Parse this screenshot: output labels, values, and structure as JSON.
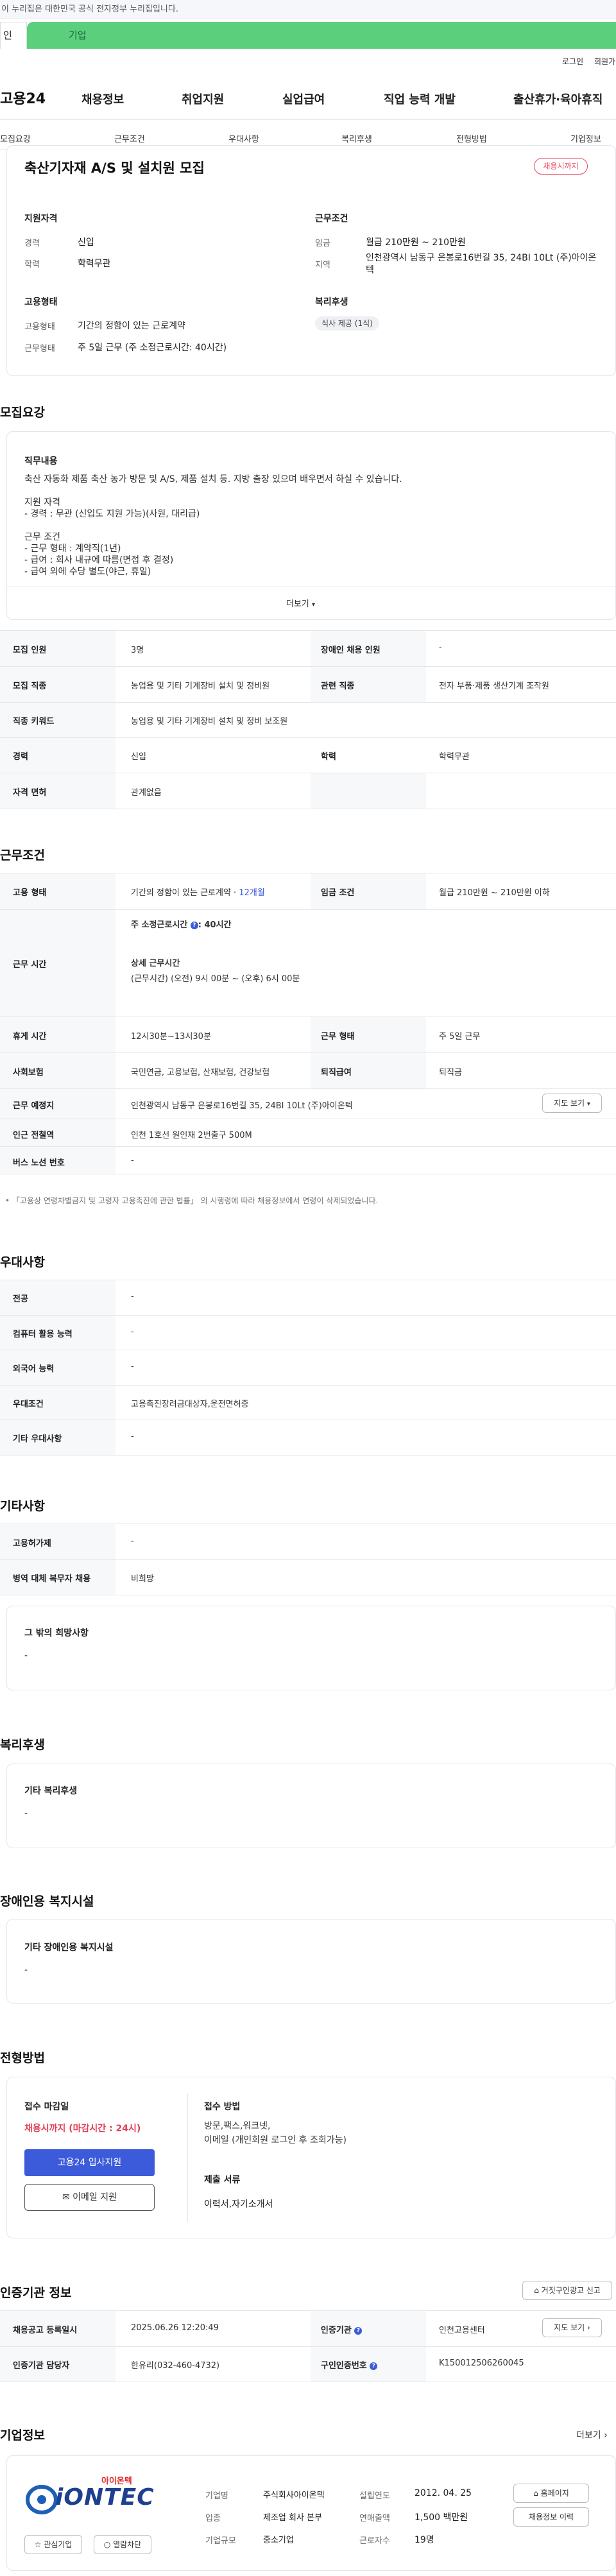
{
  "gov_banner": "이 누리집은 대한민국 공식 전자정부 누리집입니다.",
  "tabs": {
    "a": "인",
    "b": "기업"
  },
  "util": {
    "login": "로그인",
    "join": "회원가"
  },
  "logo": "고용24",
  "gnb": [
    "채용정보",
    "취업지원",
    "실업급여",
    "직업 능력 개발",
    "출산휴가·육아휴직"
  ],
  "subnav": [
    "모집요강",
    "근무조건",
    "우대사항",
    "복리후생",
    "전형방법",
    "기업정보"
  ],
  "job": {
    "title": "축산기자재 A/S 및 설치원 모집",
    "status_badge": "채용시까지",
    "qual_title": "지원자격",
    "career_lbl": "경력",
    "career_val": "신입",
    "edu_lbl": "학력",
    "edu_val": "학력무관",
    "cond_title": "근무조건",
    "wage_lbl": "임금",
    "wage_val": "월급 210만원 ~ 210만원",
    "region_lbl": "지역",
    "region_val": "인천광역시 남동구 은봉로16번길 35, 24BI 10Lt (주)아이온텍",
    "emp_title": "고용형태",
    "emp_lbl": "고용형태",
    "emp_val": "기간의 정함이 있는 근로계약",
    "work_lbl": "근무형태",
    "work_val": "주 5일 근무 (주 소정근로시간: 40시간)",
    "welfare_title": "복리후생",
    "welfare_badge": "식사 제공 (1식)"
  },
  "recruit": {
    "section": "모집요강",
    "duty_title": "직무내용",
    "duty_text": "축산 자동화 제품 축산 농가 방문 및 A/S, 제품 설치 등. 지방 출장 있으며 배우면서 하실 수 있습니다.\n\n지원 자격\n - 경력 : 무관 (신입도 지원 가능)(사원, 대리급)\n\n근무 조건\n - 근무 형태 : 계약직(1년)\n - 급여 : 회사 내규에 따름(면접 후 결정)\n - 급여 외에 수당 별도(야근, 휴일)",
    "more": "더보기",
    "rows": [
      {
        "h1": "모집 인원",
        "v1": "3명",
        "h2": "장애인 채용 인원",
        "v2": "-"
      },
      {
        "h1": "모집 직종",
        "v1": "농업용 및 기타 기계장비 설치 및 정비원",
        "h2": "관련 직종",
        "v2": "전자 부품·제품 생산기계 조작원"
      },
      {
        "h1": "직종 키워드",
        "v1": "농업용 및 기타 기계장비 설치 및 정비 보조원"
      },
      {
        "h1": "경력",
        "v1": "신입",
        "h2": "학력",
        "v2": "학력무관"
      },
      {
        "h1": "자격 면허",
        "v1": "관계없음"
      }
    ]
  },
  "work": {
    "section": "근무조건",
    "emp_h": "고용 형태",
    "emp_v": "기간의 정함이 있는 근로계약 · ",
    "emp_v2": "12개월",
    "wage_h": "임금 조건",
    "wage_v": "월급 210만원 ~ 210만원 이하",
    "time_h": "근무 시간",
    "time_v1": "주 소정근로시간",
    "time_v1b": ": 40시간",
    "time_v2": "상세 근무시간",
    "time_v3": "(근무시간) (오전) 9시 00분 ~ (오후) 6시 00분",
    "rest_h": "휴게 시간",
    "rest_v": "12시30분~13시30분",
    "form_h": "근무 형태",
    "form_v": "주 5일 근무",
    "ins_h": "사회보험",
    "ins_v": "국민연금, 고용보험, 산재보험, 건강보험",
    "ret_h": "퇴직급여",
    "ret_v": "퇴직금",
    "place_h": "근무 예정지",
    "place_v": "인천광역시 남동구 은봉로16번길 35, 24BI 10Lt (주)아이온텍",
    "map_btn": "지도 보기",
    "sub_h": "인근 전철역",
    "sub_v": "인천 1호선 원인재 2번출구 500M",
    "bus_h": "버스 노선 번호",
    "bus_v": "-",
    "note": "「고용상 연령차별금지 및 고령자 고용촉진에 관한 법률」 의 시행령에 따라 채용정보에서 연령이 삭제되었습니다."
  },
  "pref": {
    "section": "우대사항",
    "rows": [
      {
        "h": "전공",
        "v": "-"
      },
      {
        "h": "컴퓨터 활용 능력",
        "v": "-"
      },
      {
        "h": "외국어 능력",
        "v": "-"
      },
      {
        "h": "우대조건",
        "v": "고용촉진장려금대상자,운전면허증"
      },
      {
        "h": "기타 우대사항",
        "v": "-"
      }
    ]
  },
  "etc": {
    "section": "기타사항",
    "rows": [
      {
        "h": "고용허가제",
        "v": "-"
      },
      {
        "h": "병역 대체 복무자 채용",
        "v": "비희망"
      }
    ],
    "box_title": "그 밖의 희망사항",
    "box_val": "-"
  },
  "welfare": {
    "section": "복리후생",
    "box_title": "기타 복리후생",
    "box_val": "-"
  },
  "disabled": {
    "section": "장애인용 복지시설",
    "box_title": "기타 장애인용 복지시설",
    "box_val": "-"
  },
  "screen": {
    "section": "전형방법",
    "deadline_lbl": "접수 마감일",
    "deadline_val": "채용시까지 (마감시간 : 24시)",
    "apply_btn": "고용24 입사지원",
    "email_btn": "이메일 지원",
    "method_lbl": "접수 방법",
    "method_val": "방문,팩스,워크넷,\n이메일 (개인회원 로그인 후 조회가능)",
    "docs_lbl": "제출 서류",
    "docs_val": "이력서,자기소개서"
  },
  "cert": {
    "section": "인증기관 정보",
    "report_btn": "거짓구인광고 신고",
    "r1h1": "채용공고 등록일시",
    "r1v1": "2025.06.26 12:20:49",
    "r1h2": "인증기관",
    "r1v2": "인천고용센터",
    "map_btn": "지도 보기",
    "r2h1": "인증기관 담당자",
    "r2v1": "한유리(032-460-4732)",
    "r2h2": "구인인증번호",
    "r2v2": "K150012506260045"
  },
  "company": {
    "section": "기업정보",
    "more": "더보기",
    "logo_top": "아이온텍",
    "logo_main": "iONTEC",
    "f": [
      {
        "l": "기업명",
        "v": "주식회사아이온텍"
      },
      {
        "l": "업종",
        "v": "제조업 회사 본부"
      },
      {
        "l": "기업규모",
        "v": "중소기업"
      }
    ],
    "g": [
      {
        "l": "설립연도",
        "v": "2012. 04. 25"
      },
      {
        "l": "연매출액",
        "v": "1,500 백만원"
      },
      {
        "l": "근로자수",
        "v": "19명"
      }
    ],
    "homepage_btn": "홈페이지",
    "jobs_btn": "채용정보 이력",
    "fav_btn": "관심기업",
    "block_btn": "열람차단"
  }
}
